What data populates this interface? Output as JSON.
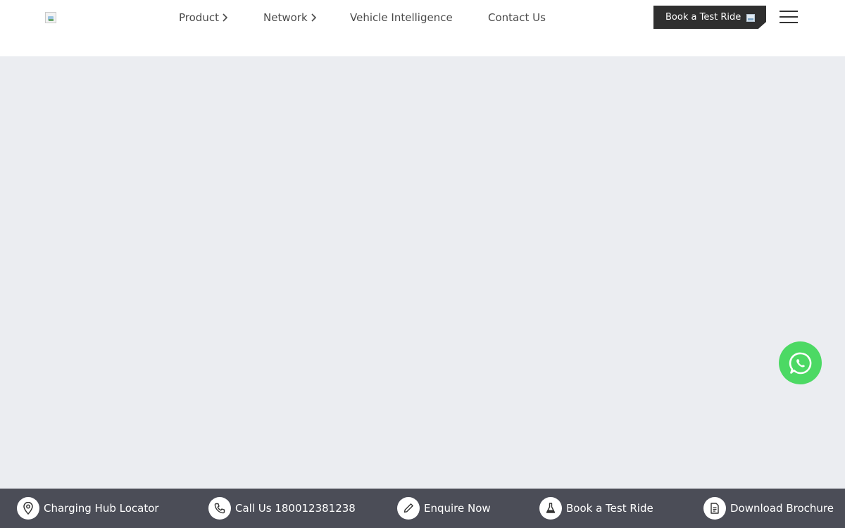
{
  "header": {
    "nav": [
      {
        "label": "Product",
        "has_chevron": true
      },
      {
        "label": "Network",
        "has_chevron": true
      },
      {
        "label": "Vehicle Intelligence",
        "has_chevron": false
      },
      {
        "label": "Contact Us",
        "has_chevron": false
      }
    ],
    "cta_label": "Book a Test Ride",
    "menu_icon": "hamburger-icon"
  },
  "floating": {
    "icon": "whatsapp-icon",
    "color": "#4cd964"
  },
  "bottom_bar": {
    "items": [
      {
        "label": "Charging Hub Locator",
        "icon": "location-pin-icon"
      },
      {
        "label": "Call Us 180012381238",
        "icon": "phone-icon"
      },
      {
        "label": "Enquire Now",
        "icon": "pencil-icon"
      },
      {
        "label": "Book a Test Ride",
        "icon": "flask-icon"
      },
      {
        "label": "Download Brochure",
        "icon": "document-icon"
      }
    ]
  },
  "colors": {
    "header_bg": "#ffffff",
    "hero_bg": "#ebedf1",
    "cta_bg": "#2f2f2f",
    "bottom_bar_bg": "#4b4d57"
  }
}
